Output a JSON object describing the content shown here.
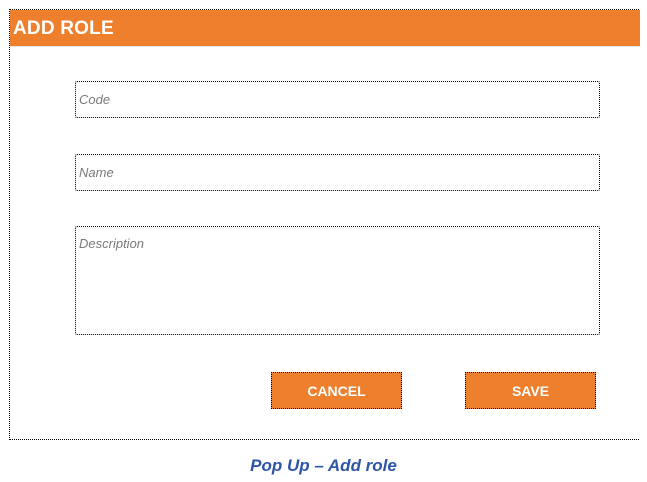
{
  "dialog": {
    "title": "ADD ROLE",
    "fields": {
      "code_placeholder": "Code",
      "code_value": "",
      "name_placeholder": "Name",
      "name_value": "",
      "description_placeholder": "Description",
      "description_value": ""
    },
    "buttons": {
      "cancel_label": "CANCEL",
      "save_label": "SAVE"
    }
  },
  "caption": "Pop Up – Add role",
  "colors": {
    "accent": "#ee7f2d",
    "caption": "#2e56a8",
    "title_text": "#ffffff"
  }
}
